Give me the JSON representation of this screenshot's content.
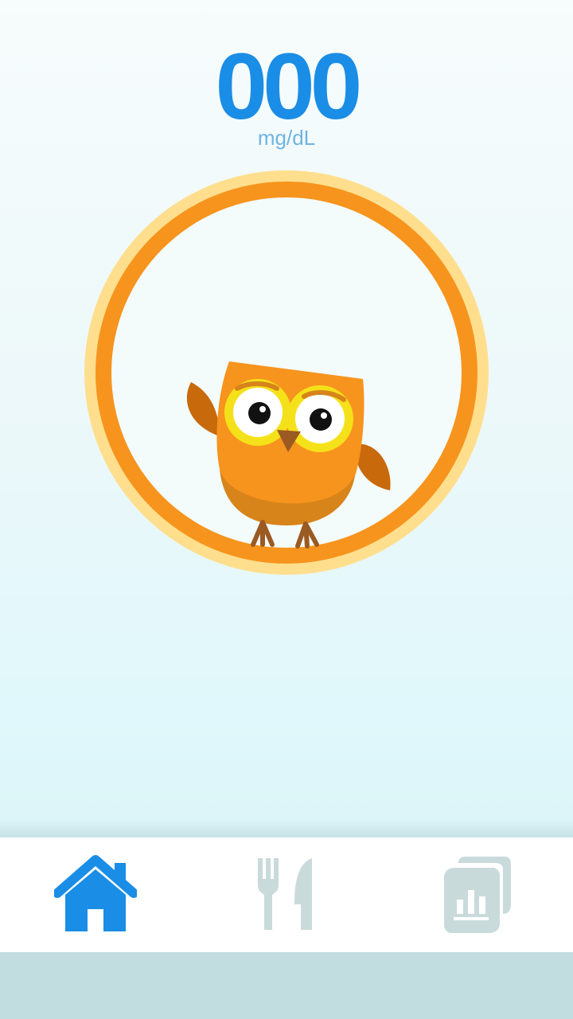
{
  "reading": {
    "value": "000",
    "unit": "mg/dL"
  },
  "mascot": {
    "icon": "owl-icon"
  },
  "nav": {
    "items": [
      {
        "name": "home",
        "icon": "home-icon",
        "active": true
      },
      {
        "name": "food",
        "icon": "fork-knife-icon",
        "active": false
      },
      {
        "name": "reports",
        "icon": "report-chart-icon",
        "active": false
      }
    ]
  },
  "colors": {
    "accent": "#1a8de6",
    "ring": "#f7941d",
    "ring_glow": "#ffdf8e",
    "nav_inactive": "#c9dadb"
  }
}
